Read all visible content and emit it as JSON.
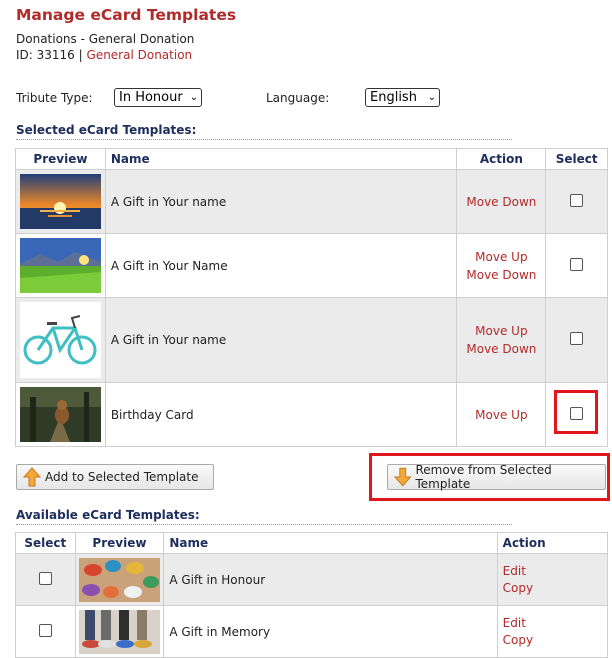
{
  "header": {
    "title": "Manage eCard Templates",
    "subtitle": "Donations - General Donation",
    "id_label": "ID: 33116",
    "separator": "|",
    "id_link": "General Donation"
  },
  "filters": {
    "tribute_label": "Tribute Type:",
    "tribute_value": "In Honour",
    "language_label": "Language:",
    "language_value": "English"
  },
  "selected": {
    "heading": "Selected eCard Templates:",
    "columns": [
      "Preview",
      "Name",
      "Action",
      "Select"
    ],
    "rows": [
      {
        "name": "A Gift in Your name",
        "actions": [
          "Move Down"
        ],
        "preview": "sunset-image"
      },
      {
        "name": "A Gift in Your Name",
        "actions": [
          "Move Up",
          "Move Down"
        ],
        "preview": "meadow-image"
      },
      {
        "name": "A Gift in Your name",
        "actions": [
          "Move Up",
          "Move Down"
        ],
        "preview": "bicycle-image"
      },
      {
        "name": "Birthday Card",
        "actions": [
          "Move Up"
        ],
        "preview": "dog-image"
      }
    ]
  },
  "buttons": {
    "add": "Add to Selected Template",
    "remove": "Remove from Selected Template"
  },
  "available": {
    "heading": "Available eCard Templates:",
    "columns": [
      "Select",
      "Preview",
      "Name",
      "Action"
    ],
    "rows": [
      {
        "name": "A Gift in Honour",
        "actions": [
          "Edit",
          "Copy"
        ],
        "preview": "shoes-image"
      },
      {
        "name": "A Gift in Memory",
        "actions": [
          "Edit",
          "Copy"
        ],
        "preview": "legs-image"
      }
    ]
  },
  "colors": {
    "accent": "#b22a2a",
    "heading": "#1d2e5c",
    "highlight": "#e0161a"
  }
}
